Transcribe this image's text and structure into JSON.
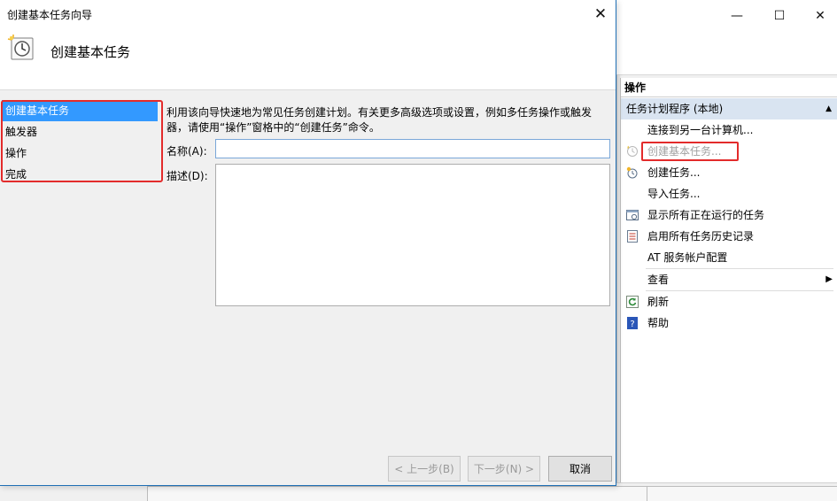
{
  "wizard": {
    "title": "创建基本任务向导",
    "close_glyph": "✕",
    "header_title": "创建基本任务",
    "header_icon": "clock-icon",
    "steps": [
      {
        "label": "创建基本任务",
        "active": true
      },
      {
        "label": "触发器",
        "active": false
      },
      {
        "label": "操作",
        "active": false
      },
      {
        "label": "完成",
        "active": false
      }
    ],
    "description_line1": "利用该向导快速地为常见任务创建计划。有关更多高级选项或设置，例如多任务操作或触发",
    "description_line2": "器，请使用“操作”窗格中的“创建任务”命令。",
    "name_label": "名称(A):",
    "name_value": "",
    "desc_label": "描述(D):",
    "desc_value": "",
    "buttons": {
      "back": "< 上一步(B)",
      "next": "下一步(N) >",
      "cancel": "取消"
    }
  },
  "main_window": {
    "minimize_glyph": "—",
    "maximize_glyph": "☐",
    "close_glyph": "✕",
    "actions_pane": {
      "header": "操作",
      "group": "任务计划程序 (本地)",
      "group_collapse_glyph": "▲",
      "items": [
        {
          "label": "连接到另一台计算机...",
          "icon": "",
          "disabled": false
        },
        {
          "label": "创建基本任务...",
          "icon": "basic-task-icon",
          "disabled": true
        },
        {
          "label": "创建任务...",
          "icon": "create-task-icon",
          "disabled": false
        },
        {
          "label": "导入任务...",
          "icon": "",
          "disabled": false
        },
        {
          "label": "显示所有正在运行的任务",
          "icon": "running-tasks-icon",
          "disabled": false
        },
        {
          "label": "启用所有任务历史记录",
          "icon": "history-icon",
          "disabled": false
        },
        {
          "label": "AT 服务帐户配置",
          "icon": "",
          "disabled": false
        },
        {
          "label": "查看",
          "icon": "",
          "disabled": false,
          "submenu": true
        },
        {
          "label": "刷新",
          "icon": "refresh-icon",
          "disabled": false
        },
        {
          "label": "帮助",
          "icon": "help-icon",
          "disabled": false
        }
      ],
      "submenu_glyph": "▶"
    }
  }
}
